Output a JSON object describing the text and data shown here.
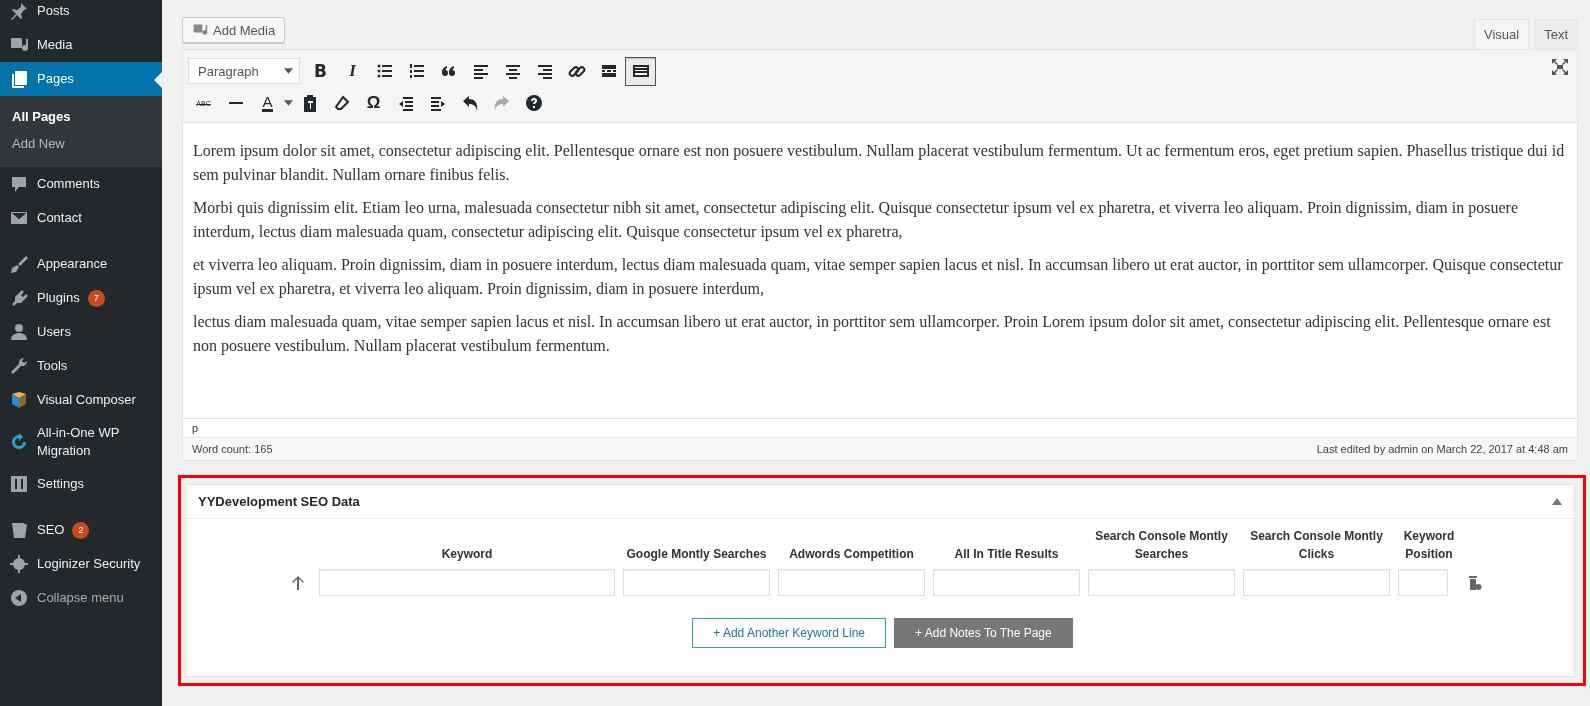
{
  "sidebar": {
    "items": [
      {
        "label": "Posts",
        "selected": false
      },
      {
        "label": "Media",
        "selected": false
      },
      {
        "label": "Pages",
        "selected": true,
        "children": [
          {
            "label": "All Pages",
            "selected": true
          },
          {
            "label": "Add New",
            "selected": false
          }
        ]
      },
      {
        "label": "Comments",
        "selected": false
      },
      {
        "label": "Contact",
        "selected": false
      },
      {
        "kind": "separator"
      },
      {
        "label": "Appearance",
        "selected": false
      },
      {
        "label": "Plugins",
        "selected": false,
        "badge": "7"
      },
      {
        "label": "Users",
        "selected": false
      },
      {
        "label": "Tools",
        "selected": false
      },
      {
        "label": "Visual Composer",
        "selected": false
      },
      {
        "label": "All-in-One WP Migration",
        "selected": false
      },
      {
        "label": "Settings",
        "selected": false
      },
      {
        "kind": "separator"
      },
      {
        "label": "SEO",
        "selected": false,
        "badge": "2"
      },
      {
        "label": "Loginizer Security",
        "selected": false
      },
      {
        "label": "Collapse menu",
        "selected": false,
        "kind": "collapse"
      }
    ]
  },
  "editor": {
    "add_media": "Add Media",
    "tabs": [
      {
        "label": "Visual",
        "selected": true
      },
      {
        "label": "Text",
        "selected": false
      }
    ],
    "format_select": "Paragraph",
    "toolbar_row_1": [
      {
        "kind": "bold",
        "glyph": "B",
        "pressed": false
      },
      {
        "kind": "italic",
        "glyph": "I",
        "pressed": false
      },
      {
        "kind": "bullet-list",
        "pressed": false
      },
      {
        "kind": "numbered-list",
        "pressed": false
      },
      {
        "kind": "blockquote",
        "pressed": false
      },
      {
        "kind": "align-left",
        "pressed": false
      },
      {
        "kind": "align-center",
        "pressed": false
      },
      {
        "kind": "align-right",
        "pressed": false
      },
      {
        "kind": "link",
        "pressed": false
      },
      {
        "kind": "read-more",
        "pressed": false
      },
      {
        "kind": "toolbar-toggle",
        "pressed": true
      }
    ],
    "toolbar_row_2": [
      {
        "kind": "strikethrough",
        "glyph": "ABC",
        "disabled": false
      },
      {
        "kind": "hr",
        "disabled": false
      },
      {
        "kind": "text-color",
        "glyph": "A",
        "disabled": false
      },
      {
        "kind": "paste-text",
        "disabled": false
      },
      {
        "kind": "clear-format",
        "disabled": false
      },
      {
        "kind": "special-char",
        "glyph": "Ω",
        "disabled": false
      },
      {
        "kind": "outdent",
        "disabled": false
      },
      {
        "kind": "indent",
        "disabled": false
      },
      {
        "kind": "undo",
        "disabled": false
      },
      {
        "kind": "redo",
        "disabled": true
      },
      {
        "kind": "help",
        "disabled": false
      }
    ],
    "paragraphs": [
      "Lorem ipsum dolor sit amet, consectetur adipiscing elit. Pellentesque ornare est non posuere vestibulum. Nullam placerat vestibulum fermentum. Ut ac fermentum eros, eget pretium sapien. Phasellus tristique dui id sem pulvinar blandit. Nullam ornare finibus felis.",
      "Morbi quis dignissim elit. Etiam leo urna, malesuada consectetur nibh sit amet, consectetur adipiscing elit. Quisque consectetur ipsum vel ex pharetra, et viverra leo aliquam. Proin dignissim, diam in posuere interdum, lectus diam malesuada quam, consectetur adipiscing elit. Quisque consectetur ipsum vel ex pharetra,",
      "et viverra leo aliquam. Proin dignissim, diam in posuere interdum, lectus diam malesuada quam, vitae semper sapien lacus et nisl. In accumsan libero ut erat auctor, in porttitor sem ullamcorper. Quisque consectetur ipsum vel ex pharetra, et viverra leo aliquam. Proin dignissim, diam in posuere interdum,",
      "lectus diam malesuada quam, vitae semper sapien lacus et nisl. In accumsan libero ut erat auctor, in porttitor sem ullamcorper. Proin Lorem ipsum dolor sit amet, consectetur adipiscing elit. Pellentesque ornare est non posuere vestibulum. Nullam placerat vestibulum fermentum."
    ],
    "path": "p",
    "word_count": "Word count: 165",
    "last_edited": "Last edited by admin on March 22, 2017 at 4:48 am"
  },
  "seo_box": {
    "title": "YYDevelopment SEO Data",
    "highlighted": true,
    "expanded": true,
    "columns": [
      "Keyword",
      "Google Montly Searches",
      "Adwords Competition",
      "All In Title Results",
      "Search Console Montly Searches",
      "Search Console Montly Clicks",
      "Keyword Position"
    ],
    "buttons": [
      {
        "label": "+ Add Another Keyword Line",
        "kind": "outline"
      },
      {
        "label": "+ Add Notes To The Page",
        "kind": "filled"
      }
    ]
  }
}
